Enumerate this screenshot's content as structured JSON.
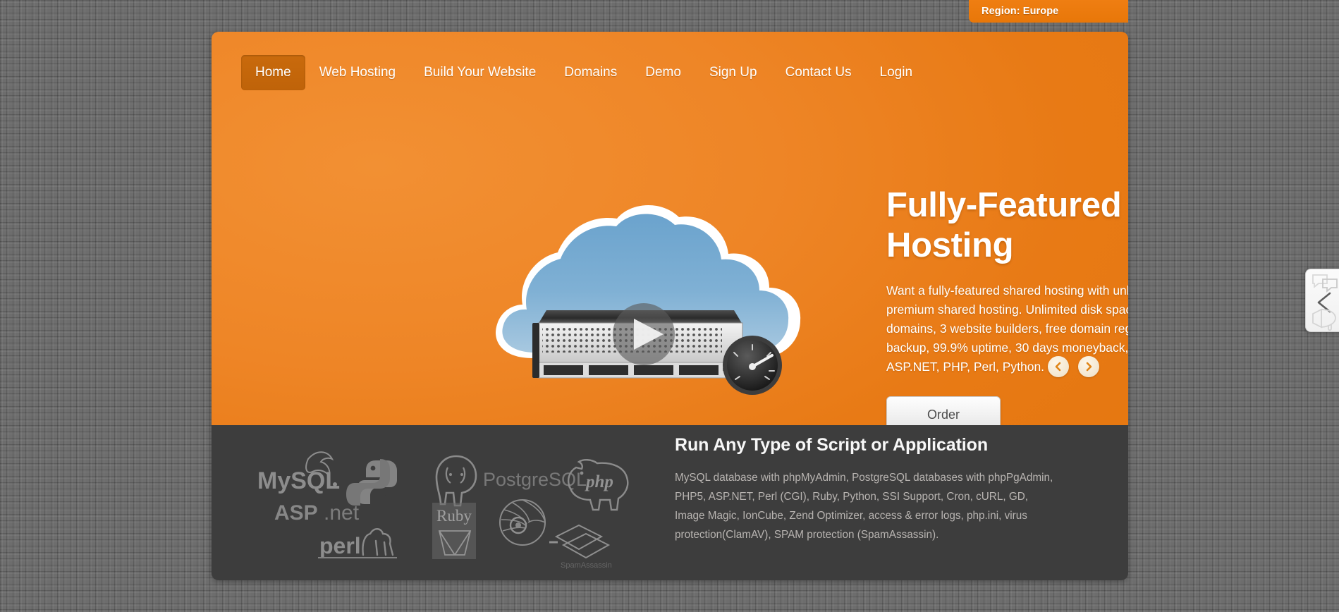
{
  "region_tab": {
    "label": "Region: Europe"
  },
  "nav": {
    "items": [
      {
        "label": "Home",
        "active": true
      },
      {
        "label": "Web Hosting",
        "active": false
      },
      {
        "label": "Build Your Website",
        "active": false
      },
      {
        "label": "Domains",
        "active": false
      },
      {
        "label": "Demo",
        "active": false
      },
      {
        "label": "Sign Up",
        "active": false
      },
      {
        "label": "Contact Us",
        "active": false
      },
      {
        "label": "Login",
        "active": false
      }
    ]
  },
  "hero": {
    "title": "Fully-Featured Shared Hosting",
    "text": "Want a fully-featured shared hosting with unlimited features - try our premium shared hosting. Unlimited disk space, data transfer & hosted domains, 3 website builders, free domain registration or transfer, data backup, 99.9% uptime, 30 days moneyback, MySQL, PostgreSQL, ASP.NET, PHP, Perl, Python.",
    "order_label": "Order",
    "image": {
      "name": "cloud-server-illustration",
      "elements": [
        "cloud",
        "rack-server",
        "speedometer-gauge",
        "play-button-overlay"
      ]
    },
    "carousel": {
      "prev_label": "Previous slide",
      "next_label": "Next slide"
    }
  },
  "panel": {
    "title": "Run Any Type of Script or Application",
    "text": "MySQL database with phpMyAdmin, PostgreSQL databases with phpPgAdmin, PHP5, ASP.NET, Perl (CGI), Ruby, Python, SSI Support, Cron, cURL, GD, Image Magic, IonCube, Zend Optimizer, access & error logs, php.ini, virus protection(ClamAV), SPAM protection (SpamAssassin).",
    "logos": [
      "MySQL",
      "Python",
      "PostgreSQL",
      "php",
      "ASP.net",
      "perl",
      "Ruby",
      "Perl",
      "SpamAssassin"
    ]
  },
  "side_widget": {
    "name": "feedback-tab",
    "icons": [
      "chat-bubbles-icon",
      "chevron-left-icon",
      "megaphone-icon"
    ]
  },
  "colors": {
    "accent_orange": "#e87a15",
    "nav_active": "#c96a0c",
    "panel_dark": "#3d3d3d",
    "page_bg": "#6d6d6d",
    "cloud_blue": "#6ca4cd"
  }
}
